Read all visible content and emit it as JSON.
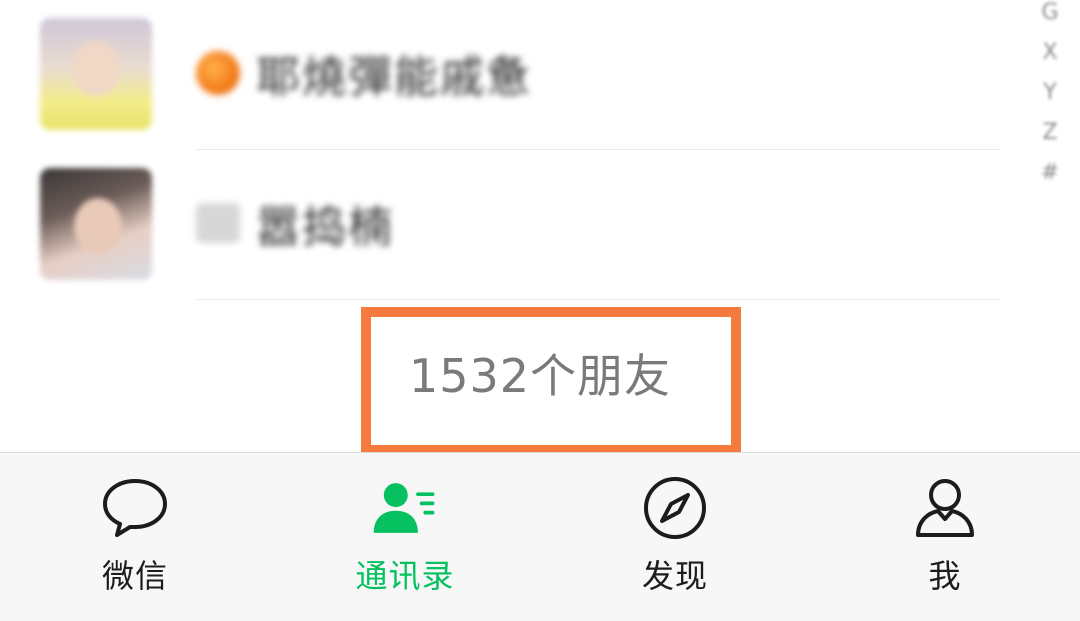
{
  "contacts": [
    {
      "name": "耶燒彈能戚惫"
    },
    {
      "name": "嚣捣楠"
    }
  ],
  "alphabet_index": [
    "G",
    "X",
    "Y",
    "Z",
    "#"
  ],
  "friend_count_text": "1532个朋友",
  "colors": {
    "active_tab": "#07c160",
    "highlight_box": "#f47b3d",
    "tab_bar_bg": "#f7f7f7"
  },
  "tabs": [
    {
      "label": "微信",
      "icon": "chat-bubble-icon",
      "active": false
    },
    {
      "label": "通讯录",
      "icon": "contacts-icon",
      "active": true
    },
    {
      "label": "发现",
      "icon": "compass-icon",
      "active": false
    },
    {
      "label": "我",
      "icon": "person-icon",
      "active": false
    }
  ]
}
